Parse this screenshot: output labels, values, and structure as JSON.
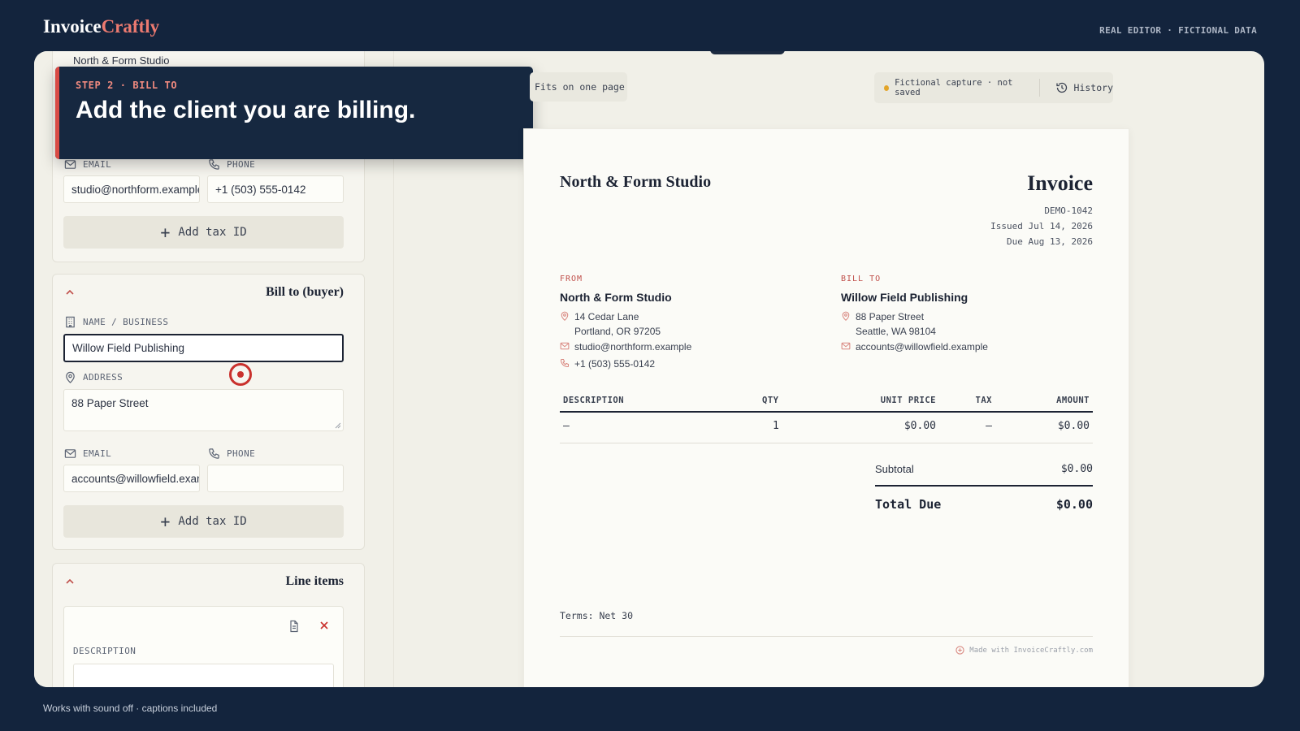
{
  "app": {
    "brand_part1": "Invoice",
    "brand_part2": "Craftly",
    "top_right": "REAL EDITOR · FICTIONAL DATA",
    "footer_note": "Works with sound off · captions included"
  },
  "colors": {
    "background": "#13243d",
    "accent": "#d94b45",
    "brand_accent": "#ec7a70",
    "status_dot": "#e3a52a"
  },
  "callout": {
    "step": "STEP 2 · BILL TO",
    "headline": "Add the client you are billing."
  },
  "seller_form": {
    "name_value": "North & Form Studio",
    "email_label": "EMAIL",
    "email_value": "studio@northform.example",
    "phone_label": "PHONE",
    "phone_value": "+1 (503) 555-0142",
    "add_tax_label": "Add tax ID"
  },
  "buyer_form": {
    "section_title": "Bill to (buyer)",
    "name_label": "NAME / BUSINESS",
    "name_value": "Willow Field Publishing",
    "address_label": "ADDRESS",
    "address_value": "88 Paper Street",
    "email_label": "EMAIL",
    "email_value": "accounts@willowfield.example",
    "phone_label": "PHONE",
    "phone_value": "",
    "add_tax_label": "Add tax ID"
  },
  "line_items_form": {
    "section_title": "Line items",
    "description_label": "DESCRIPTION"
  },
  "toolbar": {
    "fits_label": "Fits on one page",
    "status_label": "Fictional capture · not saved",
    "history_label": "History"
  },
  "invoice": {
    "company": "North & Form Studio",
    "title": "Invoice",
    "number": "DEMO-1042",
    "issued": "Issued Jul 14, 2026",
    "due": "Due Aug 13, 2026",
    "from": {
      "label": "FROM",
      "name": "North & Form Studio",
      "address1": "14 Cedar Lane",
      "address2": "Portland, OR 97205",
      "email": "studio@northform.example",
      "phone": "+1 (503) 555-0142"
    },
    "bill_to": {
      "label": "BILL TO",
      "name": "Willow Field Publishing",
      "address1": "88 Paper Street",
      "address2": "Seattle, WA 98104",
      "email": "accounts@willowfield.example"
    },
    "columns": {
      "description": "DESCRIPTION",
      "qty": "QTY",
      "unit_price": "UNIT PRICE",
      "tax": "TAX",
      "amount": "AMOUNT"
    },
    "rows": [
      {
        "description": "—",
        "qty": "1",
        "unit_price": "$0.00",
        "tax": "—",
        "amount": "$0.00"
      }
    ],
    "subtotal_label": "Subtotal",
    "subtotal_value": "$0.00",
    "total_label": "Total Due",
    "total_value": "$0.00",
    "terms": "Terms: Net 30",
    "made_with": "Made with InvoiceCraftly.com"
  }
}
